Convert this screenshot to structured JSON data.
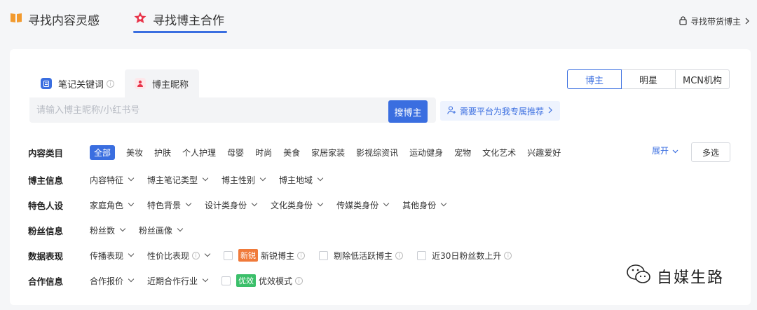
{
  "header": {
    "tabs": [
      {
        "label": "寻找内容灵感",
        "active": false
      },
      {
        "label": "寻找博主合作",
        "active": true
      }
    ],
    "right_link": "寻找带货博主"
  },
  "search": {
    "tabs": [
      {
        "label": "笔记关键词",
        "active": false
      },
      {
        "label": "博主昵称",
        "active": true
      }
    ],
    "placeholder": "请输入博主昵称/小红书号",
    "value": "",
    "button": "搜博主",
    "recommend": "需要平台为我专属推荐"
  },
  "segments": [
    "博主",
    "明星",
    "MCN机构"
  ],
  "filters": {
    "category_label": "内容类目",
    "categories": [
      "全部",
      "美妆",
      "护肤",
      "个人护理",
      "母婴",
      "时尚",
      "美食",
      "家居家装",
      "影视综资讯",
      "运动健身",
      "宠物",
      "文化艺术",
      "兴趣爱好"
    ],
    "expand": "展开",
    "multi": "多选",
    "blogger_info_label": "博主信息",
    "blogger_info": [
      "内容特征",
      "博主笔记类型",
      "博主性别",
      "博主地域"
    ],
    "persona_label": "特色人设",
    "persona": [
      "家庭角色",
      "特色背景",
      "设计类身份",
      "文化类身份",
      "传媒类身份",
      "其他身份"
    ],
    "fans_label": "粉丝信息",
    "fans": [
      "粉丝数",
      "粉丝画像"
    ],
    "data_label": "数据表现",
    "data": [
      "传播表现",
      "性价比表现"
    ],
    "data_checks": {
      "new_tag": "新锐",
      "new_label": "新锐博主",
      "low_active": "剔除低活跃博主",
      "fans_up": "近30日粉丝数上升"
    },
    "coop_label": "合作信息",
    "coop": [
      "合作报价",
      "近期合作行业"
    ],
    "coop_check": {
      "tag": "优效",
      "label": "优效模式"
    }
  },
  "watermark": "自媒生路",
  "colors": {
    "accent": "#3a6ee0",
    "new_tag": "#f07a3a",
    "eff_tag": "#3bbf6a"
  }
}
